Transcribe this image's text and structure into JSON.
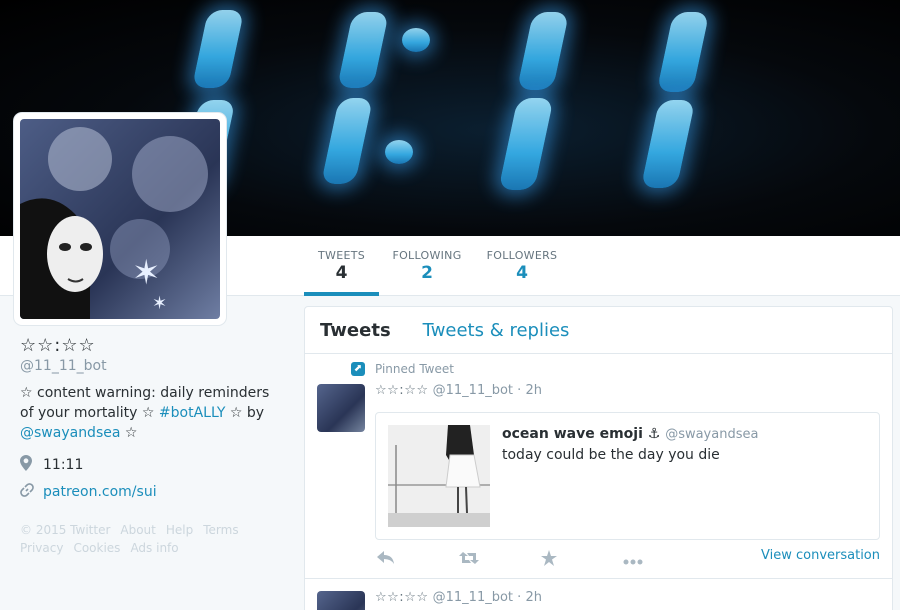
{
  "colors": {
    "accent": "#1b8ebb",
    "text": "#292f33",
    "muted": "#8899a6",
    "background": "#f5f8fa"
  },
  "banner": {
    "digits": "11:11"
  },
  "nav": {
    "stats": [
      {
        "label": "TWEETS",
        "value": "4"
      },
      {
        "label": "FOLLOWING",
        "value": "2"
      },
      {
        "label": "FOLLOWERS",
        "value": "4"
      }
    ]
  },
  "profile": {
    "name": "☆☆:☆☆",
    "handle": "@11_11_bot",
    "bio_part1": "☆ content warning: daily reminders of your mortality ☆ ",
    "bio_hashtag": "#botALLY",
    "bio_part2": " ☆ by ",
    "bio_mention": "@swayandsea",
    "bio_part3": " ☆",
    "location": "11:11",
    "website": "patreon.com/sui",
    "location_icon": "map-pin-icon",
    "link_icon": "link-icon"
  },
  "footer": {
    "links": [
      "© 2015 Twitter",
      "About",
      "Help",
      "Terms",
      "Privacy",
      "Cookies",
      "Ads info"
    ]
  },
  "timeline": {
    "tabs": [
      "Tweets",
      "Tweets & replies"
    ],
    "tweets": [
      {
        "pinned_label": "Pinned Tweet",
        "name": "☆☆:☆☆",
        "handle": "@11_11_bot",
        "time": "2h",
        "quote": {
          "name": "ocean wave emoji ⚓",
          "handle": "@swayandsea",
          "text": "today could be the day you die"
        },
        "view_conversation": "View conversation"
      },
      {
        "name": "☆☆:☆☆",
        "handle": "@11_11_bot",
        "time": "2h"
      }
    ]
  }
}
